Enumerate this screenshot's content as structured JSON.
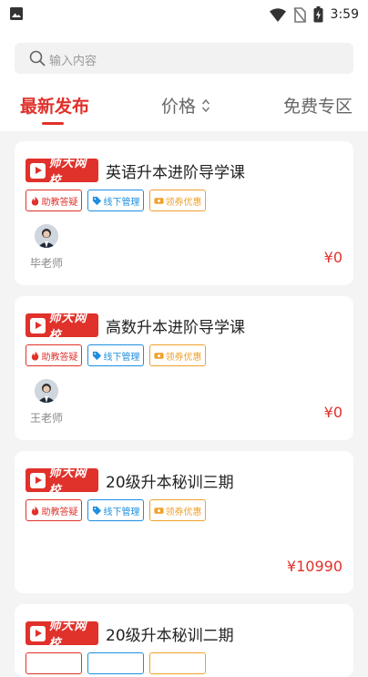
{
  "status_bar": {
    "time": "3:59",
    "icons": [
      "image-icon",
      "wifi-icon",
      "no-sim-icon",
      "battery-icon"
    ]
  },
  "search": {
    "placeholder": "输入内容"
  },
  "tabs": [
    {
      "label": "最新发布",
      "active": true
    },
    {
      "label": "价格",
      "active": false,
      "icon": "sort-icon"
    },
    {
      "label": "免费专区",
      "active": false
    }
  ],
  "brand": {
    "logo_text": "师大网校",
    "accent_color": "#e0312b"
  },
  "tag_labels": {
    "answer": "助教答疑",
    "offline": "线下管理",
    "coupon": "领券优惠"
  },
  "courses": [
    {
      "title": "英语升本进阶导学课",
      "teacher": "毕老师",
      "price": "¥0"
    },
    {
      "title": "高数升本进阶导学课",
      "teacher": "王老师",
      "price": "¥0"
    },
    {
      "title": "20级升本秘训三期",
      "teacher": "",
      "price": "¥10990"
    },
    {
      "title": "20级升本秘训二期",
      "teacher": "",
      "price": ""
    }
  ]
}
